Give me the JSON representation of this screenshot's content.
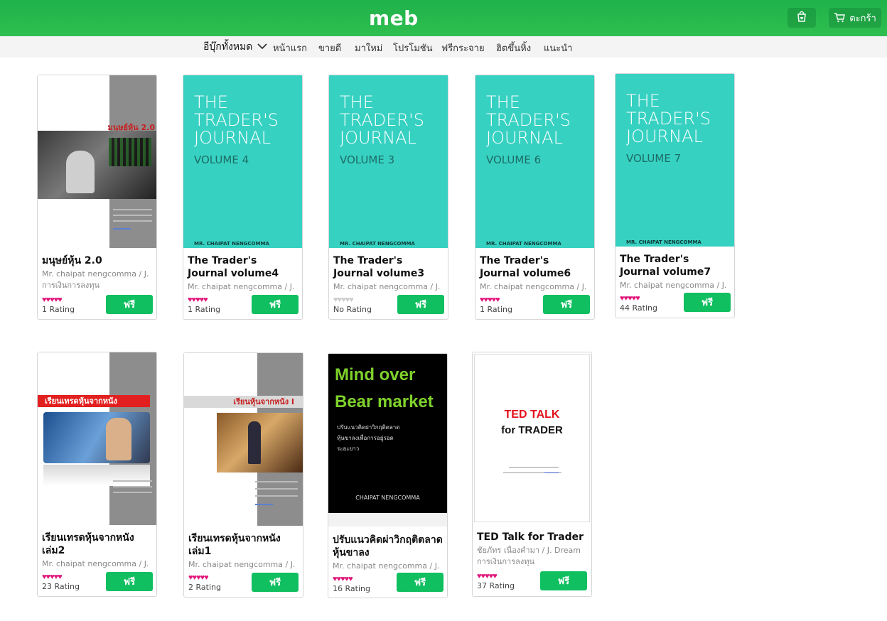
{
  "app": {
    "logo": "meb",
    "cart_label": "ตะกร้า",
    "cart_icon": "cart-icon",
    "bag_icon": "shopping-bag-icon"
  },
  "nav": {
    "all_books": "อีบุ๊กทั้งหมด",
    "items": [
      "หน้าแรก",
      "ขายดี",
      "มาใหม่",
      "โปรโมชัน",
      "ฟรีกระจาย",
      "ฮิตขึ้นหิ้ง",
      "แนะนำ"
    ]
  },
  "colors": {
    "brand_green": "#2fbf4f",
    "free_button": "#0fbf60",
    "star_pink": "#e0157a",
    "journal_teal": "#37d1c2"
  },
  "books": [
    {
      "title": "มนุษย์หุ้น 2.0",
      "author": "Mr. chaipat nengcomma / J.",
      "category": "การเงินการลงทุน",
      "stars": "♥♥♥♥♥",
      "rating": "1 Rating",
      "button": "ฟรี",
      "cover_label": "มนุษย์หุ้น 2.0"
    },
    {
      "title": "The Trader's Journal volume4",
      "author": "Mr. chaipat nengcomma / J.",
      "stars": "♥♥♥♥♥",
      "rating": "1 Rating",
      "button": "ฟรี",
      "cover_title": "THE\nTRADER'S\nJOURNAL",
      "cover_volume": "VOLUME 4",
      "cover_author": "MR. CHAIPAT NENGCOMMA"
    },
    {
      "title": "The Trader's Journal volume3",
      "author": "Mr. chaipat nengcomma / J.",
      "stars": "♥♥♥♥♥",
      "rating": "No Rating",
      "button": "ฟรี",
      "cover_title": "THE\nTRADER'S\nJOURNAL",
      "cover_volume": "VOLUME 3",
      "cover_author": "MR. CHAIPAT NENGCOMMA"
    },
    {
      "title": "The Trader's Journal volume6",
      "author": "Mr. chaipat nengcomma / J.",
      "stars": "♥♥♥♥♥",
      "rating": "1 Rating",
      "button": "ฟรี",
      "cover_title": "THE\nTRADER'S\nJOURNAL",
      "cover_volume": "VOLUME 6",
      "cover_author": "MR. CHAIPAT NENGCOMMA"
    },
    {
      "title": "The Trader's Journal volume7",
      "author": "Mr. chaipat nengcomma / J.",
      "stars": "♥♥♥♥♥",
      "rating": "44 Rating",
      "button": "ฟรี",
      "cover_title": "THE\nTRADER'S\nJOURNAL",
      "cover_volume": "VOLUME 7",
      "cover_author": "MR. CHAIPAT NENGCOMMA"
    },
    {
      "title": "เรียนเทรดหุ้นจากหนัง เล่ม2",
      "author": "Mr. chaipat nengcomma / J.",
      "stars": "♥♥♥♥♥",
      "rating": "23 Rating",
      "button": "ฟรี",
      "cover_label": "เรียนเทรดหุ้นจากหนัง"
    },
    {
      "title": "เรียนเทรดหุ้นจากหนัง เล่ม1",
      "author": "Mr. chaipat nengcomma / J.",
      "stars": "♥♥♥♥♥",
      "rating": "2 Rating",
      "button": "ฟรี",
      "cover_label": "เรียนหุ้นจากหนัง I"
    },
    {
      "title": "ปรับแนวคิดผ่าวิกฤติตลาดหุ้นขาลง",
      "author": "Mr. chaipat nengcomma / J.",
      "stars": "♥♥♥♥♥",
      "rating": "16 Rating",
      "button": "ฟรี",
      "cover_line1": "Mind over",
      "cover_line2": "Bear market",
      "cover_sub1": "ปรับแนวคิดผ่าวิกฤติตลาด",
      "cover_sub2": "หุ้นขาลงเพื่อการอยู่รอด",
      "cover_sub3": "ระยะยาว",
      "cover_author": "CHAIPAT NENGCOMMA"
    },
    {
      "title": "TED Talk for Trader",
      "author": "ชัยภัทร เนื่องคำมา / J. Dream",
      "category": "การเงินการลงทุน",
      "stars": "♥♥♥♥♥",
      "rating": "37 Rating",
      "button": "ฟรี",
      "cover_line1": "TED TALK",
      "cover_line2": "for TRADER"
    }
  ]
}
